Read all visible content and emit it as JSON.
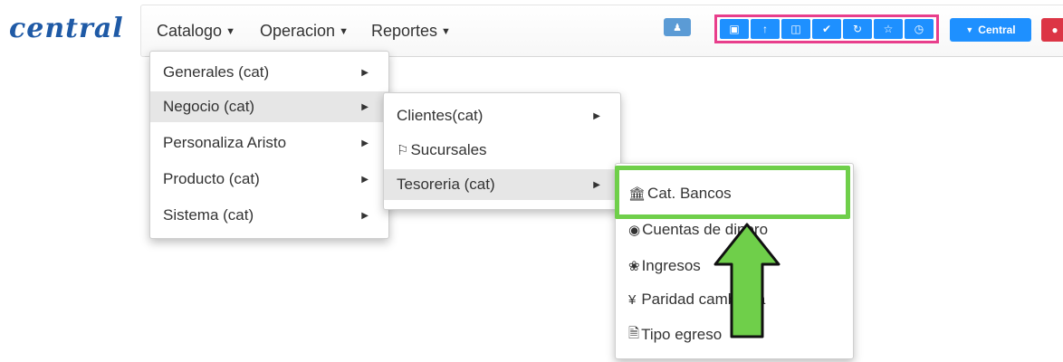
{
  "brand": {
    "name": "central"
  },
  "nav": {
    "items": [
      {
        "label": "Catalogo"
      },
      {
        "label": "Operacion"
      },
      {
        "label": "Reportes"
      }
    ]
  },
  "toolbar": {
    "tool_icons": [
      "box-icon",
      "upload-icon",
      "shield-icon",
      "check-circle-icon",
      "refresh-icon",
      "star-icon",
      "clock-icon"
    ],
    "central_label": "Central",
    "accent_color": "#1e90ff",
    "group_border_color": "#e83e8c"
  },
  "menu_level1": [
    {
      "label": "Generales (cat)"
    },
    {
      "label": "Negocio (cat)"
    },
    {
      "label": "Personaliza Aristo"
    },
    {
      "label": "Producto (cat)"
    },
    {
      "label": "Sistema (cat)"
    }
  ],
  "menu_level2": [
    {
      "label": "Clientes(cat)"
    },
    {
      "label": "Sucursales"
    },
    {
      "label": "Tesoreria (cat)"
    }
  ],
  "menu_level3": [
    {
      "label": "Cat. Bancos"
    },
    {
      "label": "Cuentas de dinero"
    },
    {
      "label": "Ingresos"
    },
    {
      "label": "Paridad cambiaria"
    },
    {
      "label": "Tipo egreso"
    }
  ],
  "annotation": {
    "highlight_color": "#6fcf4a"
  }
}
